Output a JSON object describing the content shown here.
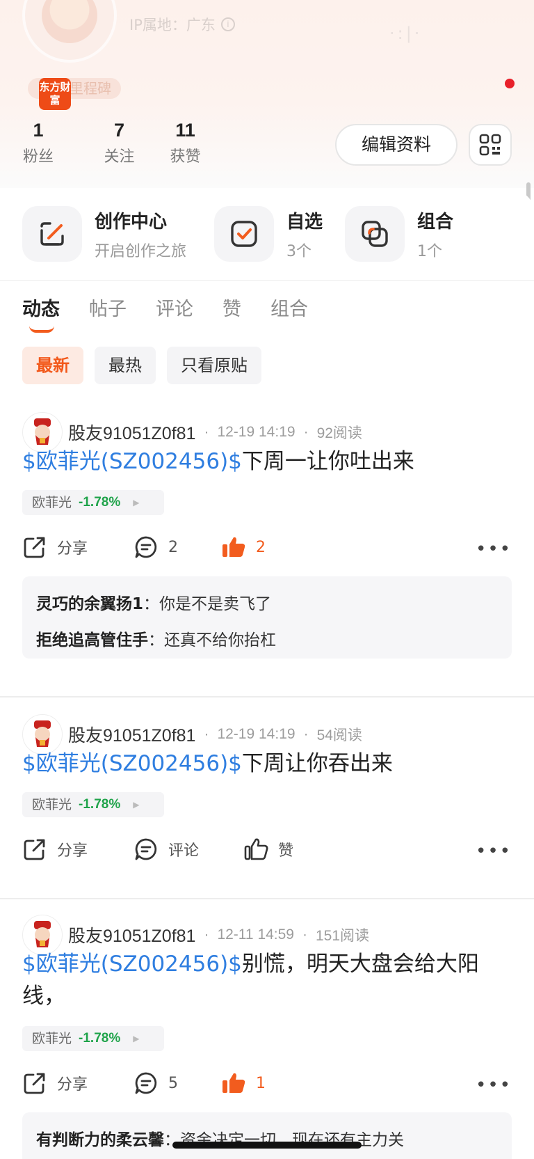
{
  "header": {
    "ip_location": "IP属地：广东",
    "milestone": "里程碑",
    "brand_logo": "东方财富",
    "stats": [
      {
        "value": "1",
        "label": "粉丝"
      },
      {
        "value": "7",
        "label": "关注"
      },
      {
        "value": "11",
        "label": "获赞"
      }
    ],
    "edit_label": "编辑资料"
  },
  "quick_entries": [
    {
      "title": "创作中心",
      "sub": "开启创作之旅",
      "icon": "edit-icon"
    },
    {
      "title": "自选",
      "sub": "3个",
      "icon": "checkbox-icon"
    },
    {
      "title": "组合",
      "sub": "1个",
      "icon": "portfolio-icon"
    }
  ],
  "tabs": [
    "动态",
    "帖子",
    "评论",
    "赞",
    "组合"
  ],
  "filters": [
    "最新",
    "最热",
    "只看原贴"
  ],
  "posts": [
    {
      "user": "股友91051Z0f81",
      "time": "12-19 14:19",
      "reads": "92阅读",
      "stock": "$欧菲光(SZ002456)$",
      "text": "下周一让你吐出来",
      "tag_name": "欧菲光",
      "tag_pct": "-1.78%",
      "share": "分享",
      "comments": "2",
      "likes": "2",
      "replies": [
        {
          "user": "灵巧的余翼扬1",
          "text": "你是不是卖飞了"
        },
        {
          "user": "拒绝追高管住手",
          "text": "还真不给你抬杠"
        }
      ]
    },
    {
      "user": "股友91051Z0f81",
      "time": "12-19 14:19",
      "reads": "54阅读",
      "stock": "$欧菲光(SZ002456)$",
      "text": "下周让你吞出来",
      "tag_name": "欧菲光",
      "tag_pct": "-1.78%",
      "share": "分享",
      "comments": "评论",
      "likes": "赞"
    },
    {
      "user": "股友91051Z0f81",
      "time": "12-11 14:59",
      "reads": "151阅读",
      "stock": "$欧菲光(SZ002456)$",
      "text": "别慌，明天大盘会给大阳线，",
      "tag_name": "欧菲光",
      "tag_pct": "-1.78%",
      "share": "分享",
      "comments": "5",
      "likes": "1",
      "replies": [
        {
          "user": "有判断力的柔云馨",
          "text": "资金决定一切，现在还有主力关"
        }
      ]
    }
  ],
  "colors": {
    "accent": "#f25c1e",
    "stock_link": "#2f7ee0",
    "down_green": "#1fa34a"
  }
}
